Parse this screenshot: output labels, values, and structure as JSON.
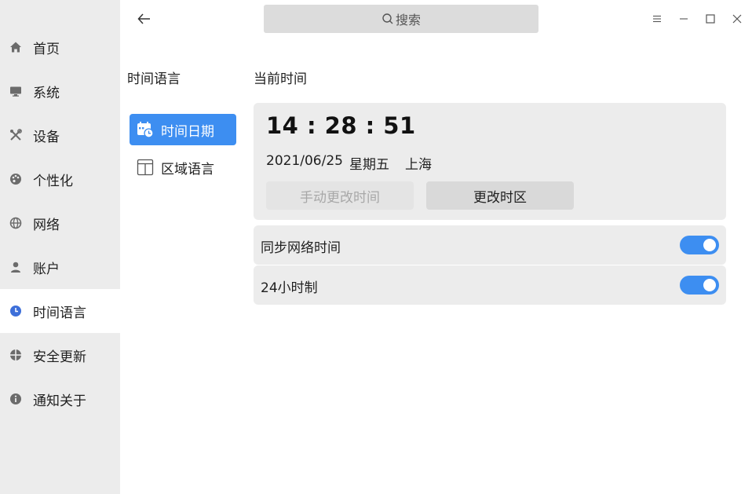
{
  "sidebar": {
    "items": [
      {
        "label": "首页",
        "icon": "home-icon"
      },
      {
        "label": "系统",
        "icon": "monitor-icon"
      },
      {
        "label": "设备",
        "icon": "tools-icon"
      },
      {
        "label": "个性化",
        "icon": "palette-icon"
      },
      {
        "label": "网络",
        "icon": "globe-icon"
      },
      {
        "label": "账户",
        "icon": "user-icon"
      },
      {
        "label": "时间语言",
        "icon": "clock-icon",
        "active": true
      },
      {
        "label": "安全更新",
        "icon": "shield-icon"
      },
      {
        "label": "通知关于",
        "icon": "info-icon"
      }
    ]
  },
  "header": {
    "search_label": "搜索"
  },
  "subnav": {
    "title": "时间语言",
    "items": [
      {
        "label": "时间日期",
        "icon": "calendar-clock-icon",
        "active": true
      },
      {
        "label": "区域语言",
        "icon": "region-language-icon"
      }
    ]
  },
  "main": {
    "section_title": "当前时间",
    "clock": "14 : 28 : 51",
    "date": "2021/06/25",
    "weekday": "星期五",
    "city": "上海",
    "manual_button": "手动更改时间",
    "timezone_button": "更改时区",
    "settings": [
      {
        "label": "同步网络时间",
        "enabled": true
      },
      {
        "label": "24小时制",
        "enabled": true
      }
    ]
  },
  "colors": {
    "accent": "#3d8ef1",
    "sidebar_bg": "#ececec",
    "card_bg": "#ececec"
  }
}
